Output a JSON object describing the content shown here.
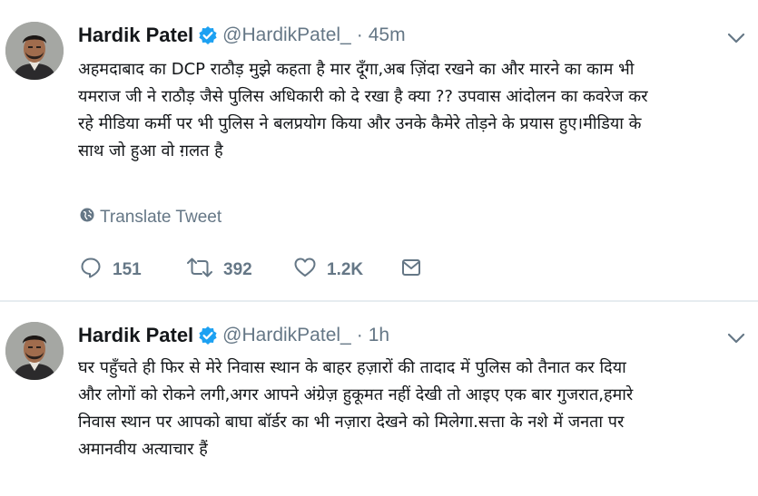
{
  "tweets": [
    {
      "name": "Hardik Patel",
      "handle": "@HardikPatel_",
      "separator": "·",
      "time": "45m",
      "lines": [
        "अहमदाबाद का DCP राठौड़ मुझे कहता है मार दूँगा,अब ज़िंदा रखने का और मारने का काम भी",
        "यमराज जी ने राठौड़ जैसे पुलिस अधिकारी को दे रखा है क्या ?? उपवास आंदोलन का कवरेज कर",
        "रहे मीडिया कर्मी पर भी पुलिस ने बलप्रयोग किया और उनके कैमेरे तोड़ने के प्रयास हुए।मीडिया के",
        "साथ जो हुआ वो ग़लत है"
      ],
      "translate_label": "Translate Tweet",
      "replies": "151",
      "retweets": "392",
      "likes": "1.2K"
    },
    {
      "name": "Hardik Patel",
      "handle": "@HardikPatel_",
      "separator": "·",
      "time": "1h",
      "lines": [
        "घर पहुँचते ही फिर से मेरे निवास स्थान के बाहर हज़ारों की तादाद में पुलिस को तैनात कर दिया",
        "और लोगों को रोकने लगी,अगर आपने अंग्रेज़ हुकूमत नहीं देखी तो आइए एक बार गुजरात,हमारे",
        "निवास स्थान पर आपको बाघा बॉर्डर का भी नज़ारा देखने को मिलेगा.सत्ता के नशे में जनता पर",
        "अमानवीय अत्याचार हैं"
      ]
    }
  ],
  "icons": {
    "verified": "verified-badge-icon",
    "caret": "chevron-down-icon",
    "globe": "globe-icon",
    "reply": "reply-icon",
    "retweet": "retweet-icon",
    "like": "heart-icon",
    "message": "direct-message-icon"
  },
  "colors": {
    "verified_blue": "#1da1f2",
    "muted_text": "#657786",
    "divider": "#e6ecf0"
  }
}
